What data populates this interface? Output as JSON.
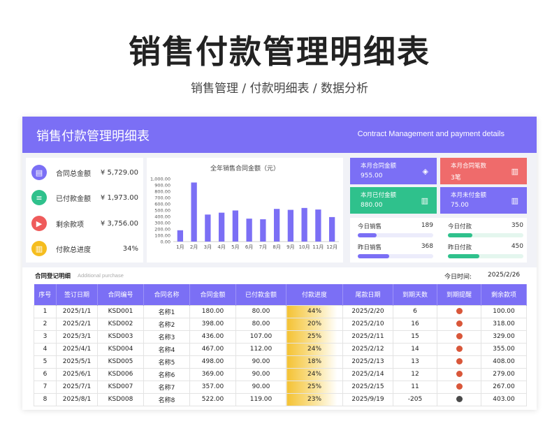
{
  "page": {
    "title": "销售付款管理明细表",
    "subtitle": "销售管理 / 付款明细表 / 数据分析"
  },
  "banner": {
    "title": "销售付款管理明细表",
    "subtitle_en": "Contract Management and payment details"
  },
  "kpis": [
    {
      "label": "合同总金额",
      "value": "¥ 5,729.00",
      "icon": "document-icon",
      "color": "#7b6ff5"
    },
    {
      "label": "已付款金额",
      "value": "¥ 1,973.00",
      "icon": "database-icon",
      "color": "#2fc18c"
    },
    {
      "label": "剩余款项",
      "value": "¥ 3,756.00",
      "icon": "video-icon",
      "color": "#ef5b5b"
    },
    {
      "label": "付款总进度",
      "value": "34%",
      "icon": "chart-icon",
      "color": "#f5bd1f"
    }
  ],
  "chart_data": {
    "type": "bar",
    "title": "全年销售合同金额（元）",
    "categories": [
      "1月",
      "2月",
      "3月",
      "4月",
      "5月",
      "6月",
      "7月",
      "8月",
      "9月",
      "10月",
      "11月",
      "12月"
    ],
    "values": [
      180,
      940,
      430,
      460,
      495,
      365,
      355,
      520,
      505,
      535,
      510,
      390
    ],
    "ylim": [
      0,
      1000
    ],
    "yticks": [
      "0.00",
      "100.00",
      "200.00",
      "300.00",
      "400.00",
      "500.00",
      "600.00",
      "700.00",
      "800.00",
      "900.00",
      "1,000.00"
    ],
    "color": "#7b6ff5"
  },
  "tiles": [
    {
      "label": "本月合同金额",
      "value": "955.00",
      "color": "#7b6ff5",
      "icon": "stack-icon"
    },
    {
      "label": "本月合同笔数",
      "value": "3笔",
      "color": "#ef6b6b",
      "icon": "bar-chart-icon"
    },
    {
      "label": "本月已付金额",
      "value": "880.00",
      "color": "#2fc18c",
      "icon": "bar-chart-icon"
    },
    {
      "label": "本月未付金额",
      "value": "75.00",
      "color": "#7b6ff5",
      "icon": "bar-chart-icon"
    }
  ],
  "mini_stats": [
    {
      "label": "今日销售",
      "value": "189",
      "progress": 0.25,
      "color": "#7b6ff5",
      "track": "#ececfb"
    },
    {
      "label": "今日付款",
      "value": "350",
      "progress": 0.32,
      "color": "#2fc18c",
      "track": "#e4f6ee"
    },
    {
      "label": "昨日销售",
      "value": "368",
      "progress": 0.42,
      "color": "#7b6ff5",
      "track": "#ececfb"
    },
    {
      "label": "昨日付款",
      "value": "450",
      "progress": 0.42,
      "color": "#2fc18c",
      "track": "#e4f6ee"
    }
  ],
  "table": {
    "title": "合同登记明细",
    "title_en": "Additional purchase",
    "today_label": "今日时间:",
    "today_value": "2025/2/26",
    "columns": [
      "序号",
      "签订日期",
      "合同编号",
      "合同名称",
      "合同金额",
      "已付款金额",
      "付款进度",
      "尾款日期",
      "到期天数",
      "到期提醒",
      "剩余款项"
    ],
    "rows": [
      [
        "1",
        "2025/1/1",
        "KSD001",
        "名称1",
        "180.00",
        "80.00",
        "44%",
        "2025/2/20",
        "6",
        "red",
        "100.00"
      ],
      [
        "2",
        "2025/2/1",
        "KSD002",
        "名称2",
        "398.00",
        "80.00",
        "20%",
        "2025/2/10",
        "16",
        "red",
        "318.00"
      ],
      [
        "3",
        "2025/3/1",
        "KSD003",
        "名称3",
        "436.00",
        "107.00",
        "25%",
        "2025/2/11",
        "15",
        "red",
        "329.00"
      ],
      [
        "4",
        "2025/4/1",
        "KSD004",
        "名称4",
        "467.00",
        "112.00",
        "24%",
        "2025/2/12",
        "14",
        "red",
        "355.00"
      ],
      [
        "5",
        "2025/5/1",
        "KSD005",
        "名称5",
        "498.00",
        "90.00",
        "18%",
        "2025/2/13",
        "13",
        "red",
        "408.00"
      ],
      [
        "6",
        "2025/6/1",
        "KSD006",
        "名称6",
        "369.00",
        "90.00",
        "24%",
        "2025/2/14",
        "12",
        "red",
        "279.00"
      ],
      [
        "7",
        "2025/7/1",
        "KSD007",
        "名称7",
        "357.00",
        "90.00",
        "25%",
        "2025/2/15",
        "11",
        "red",
        "267.00"
      ],
      [
        "8",
        "2025/8/1",
        "KSD008",
        "名称8",
        "522.00",
        "119.00",
        "23%",
        "2025/9/19",
        "-205",
        "dark",
        "403.00"
      ]
    ],
    "reminder_colors": {
      "red": "#d9573a",
      "dark": "#4a4a4a"
    }
  }
}
